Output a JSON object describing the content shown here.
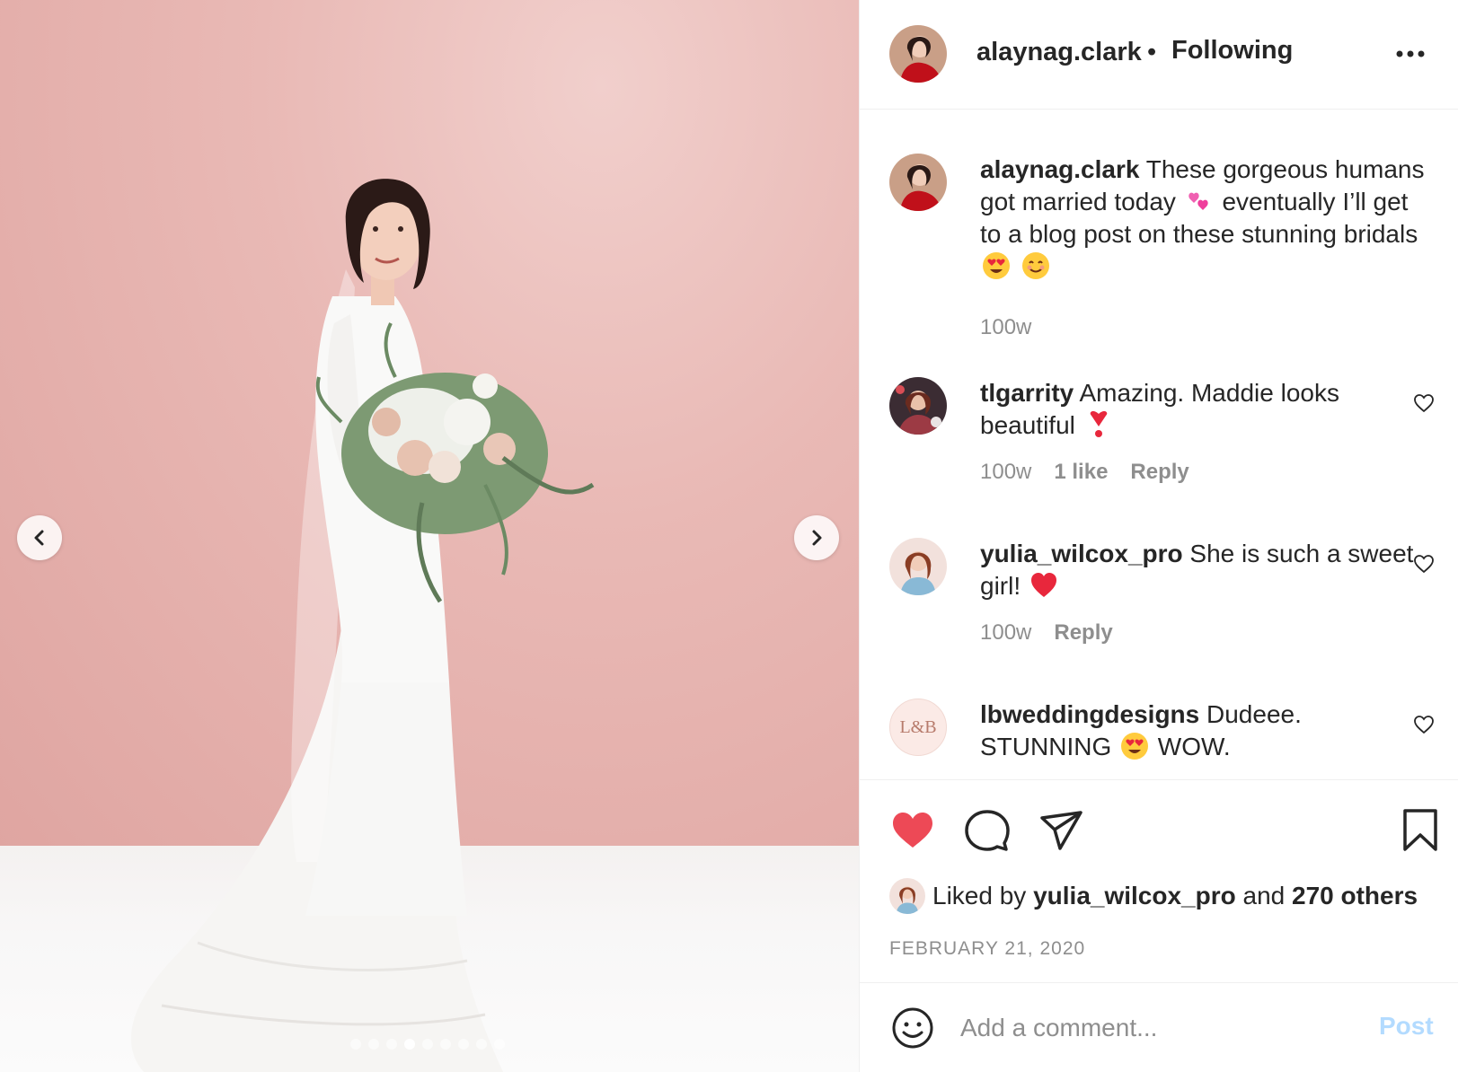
{
  "header": {
    "username": "alaynag.clark",
    "separator": "•",
    "follow_status": "Following",
    "more_icon": "more-horizontal-icon"
  },
  "caption": {
    "username": "alaynag.clark",
    "text_part1": "These gorgeous humans got married today",
    "text_part2": "eventually I’ll get to a blog post on these stunning bridals",
    "timestamp": "100w"
  },
  "comments": [
    {
      "username": "tlgarrity",
      "text": "Amazing. Maddie looks beautiful",
      "timestamp": "100w",
      "likes": "1 like",
      "reply_label": "Reply"
    },
    {
      "username": "yulia_wilcox_pro",
      "text": "She is such a sweet girl!",
      "timestamp": "100w",
      "reply_label": "Reply"
    },
    {
      "username": "lbweddingdesigns",
      "text_part1": "Dudeee. STUNNING",
      "text_part2": "WOW.",
      "avatar_text": "L&B"
    }
  ],
  "actions": {
    "liked_prefix": "Liked by",
    "liked_user": "yulia_wilcox_pro",
    "liked_and": "and",
    "liked_others": "270 others",
    "date": "FEBRUARY 21, 2020"
  },
  "add_comment": {
    "placeholder": "Add a comment...",
    "post_label": "Post"
  },
  "carousel": {
    "total": 9,
    "active_index": 3
  },
  "colors": {
    "like_red": "#ed4956",
    "post_disabled": "#b3dbff",
    "secondary_text": "#8e8e8e"
  }
}
